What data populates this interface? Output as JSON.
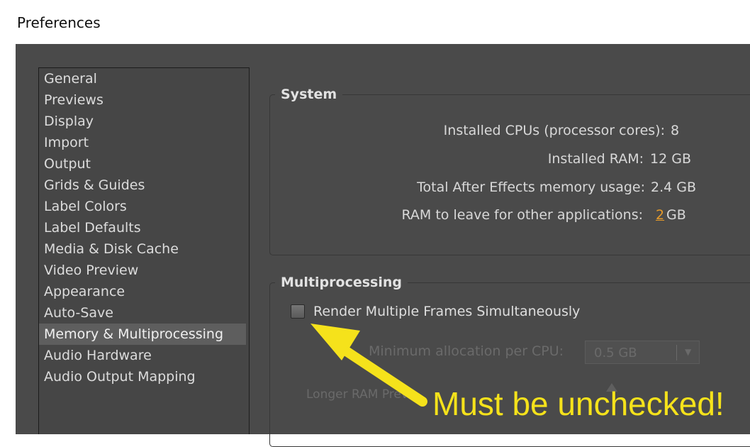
{
  "window": {
    "title": "Preferences"
  },
  "sidebar": {
    "items": [
      {
        "label": "General"
      },
      {
        "label": "Previews"
      },
      {
        "label": "Display"
      },
      {
        "label": "Import"
      },
      {
        "label": "Output"
      },
      {
        "label": "Grids & Guides"
      },
      {
        "label": "Label Colors"
      },
      {
        "label": "Label Defaults"
      },
      {
        "label": "Media & Disk Cache"
      },
      {
        "label": "Video Preview"
      },
      {
        "label": "Appearance"
      },
      {
        "label": "Auto-Save"
      },
      {
        "label": "Memory & Multiprocessing",
        "selected": true
      },
      {
        "label": "Audio Hardware"
      },
      {
        "label": "Audio Output Mapping"
      }
    ]
  },
  "system": {
    "title": "System",
    "cpus_label": "Installed CPUs (processor cores):",
    "cpus_value": "8",
    "ram_label": "Installed RAM:",
    "ram_value": "12 GB",
    "ae_usage_label": "Total After Effects memory usage:",
    "ae_usage_value": "2.4 GB",
    "leave_label": "RAM to leave for other applications:",
    "leave_value": "2",
    "leave_unit": "GB"
  },
  "multiprocessing": {
    "title": "Multiprocessing",
    "render_checkbox_label": "Render Multiple Frames Simultaneously",
    "render_checked": false,
    "min_alloc_label": "Minimum allocation per CPU:",
    "min_alloc_value": "0.5 GB",
    "longer_ram_label": "Longer RAM Previ"
  },
  "annotation": {
    "text": "Must be unchecked!",
    "color": "#f5e21b"
  },
  "colors": {
    "dialog_bg": "#4a4a4a",
    "accent": "#e59a2a"
  }
}
